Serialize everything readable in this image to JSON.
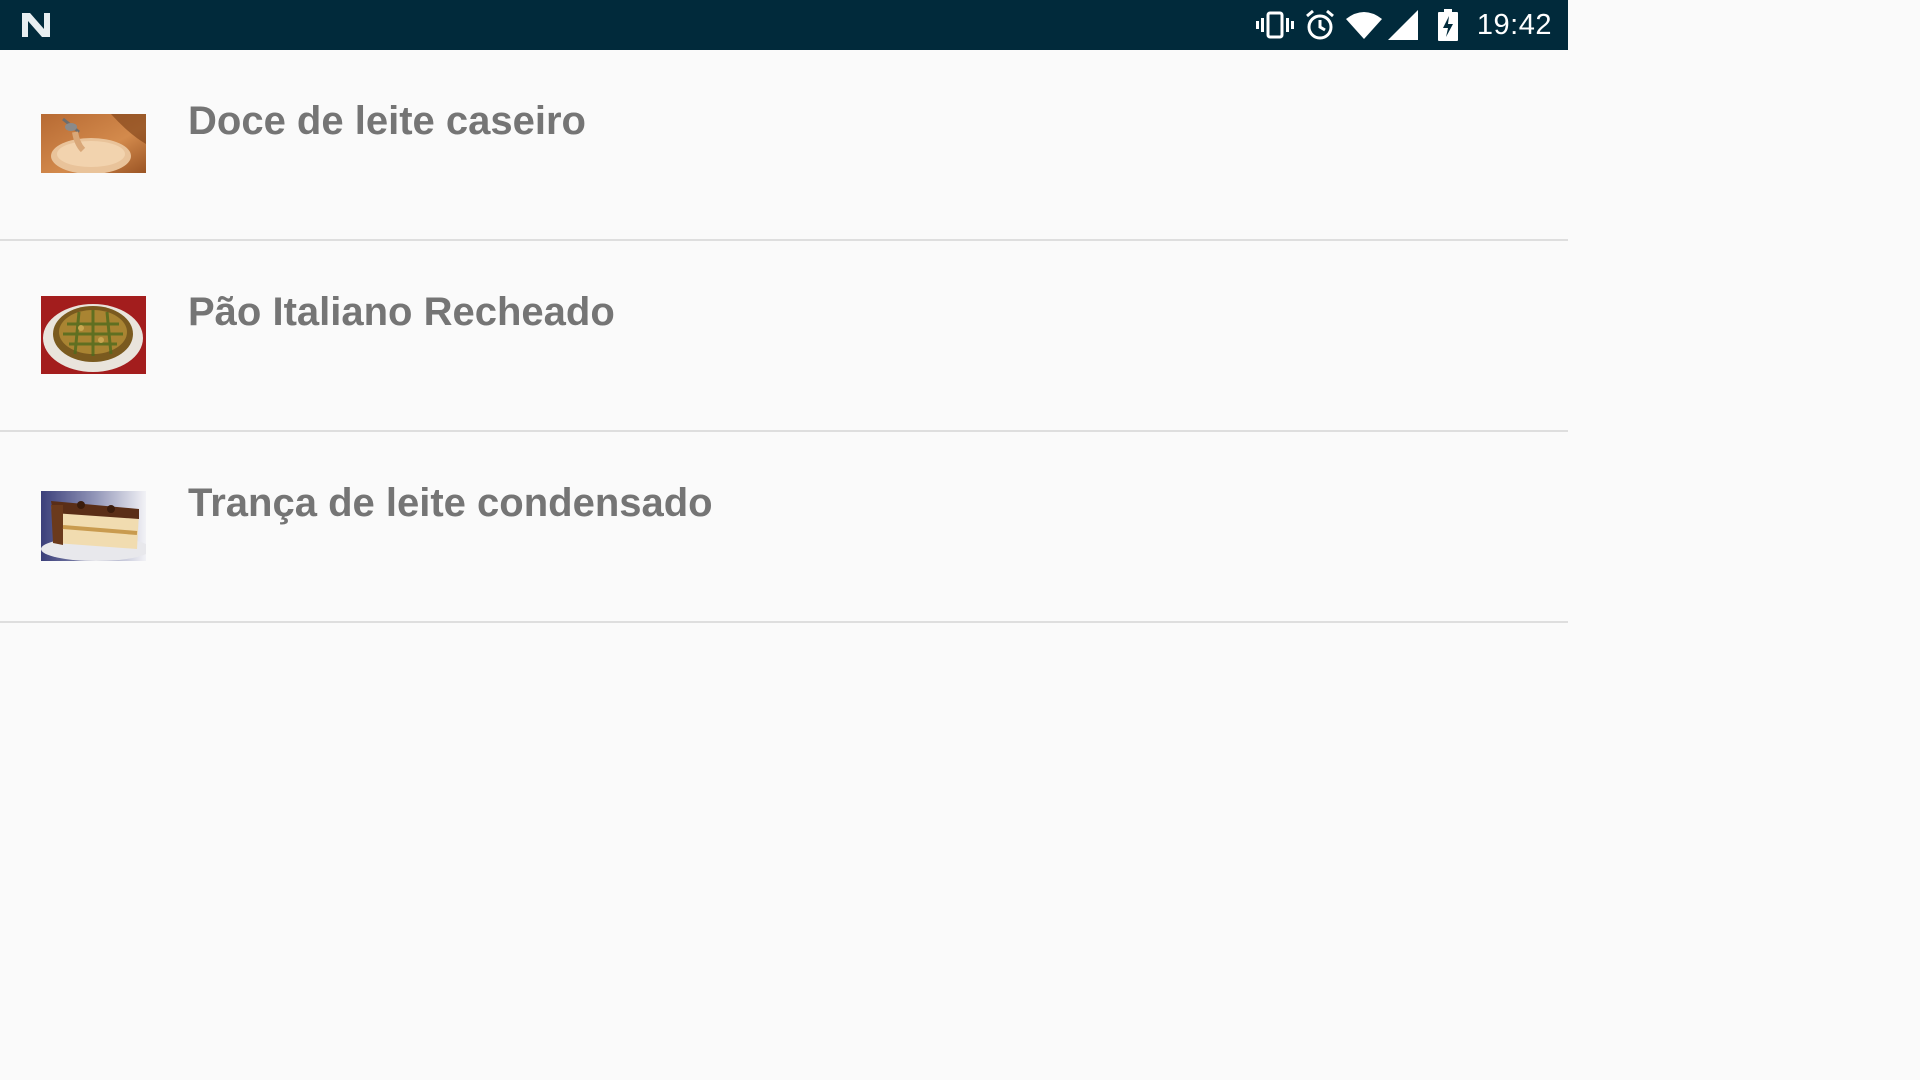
{
  "status_bar": {
    "time": "19:42",
    "icons": [
      "n-logo-icon",
      "vibrate-icon",
      "alarm-icon",
      "wifi-icon",
      "cell-signal-icon",
      "battery-charging-icon"
    ],
    "background": "#012a3b"
  },
  "recipes": [
    {
      "title": "Doce de leite caseiro",
      "thumbnail": "doce-de-leite-photo"
    },
    {
      "title": "Pão Italiano Recheado",
      "thumbnail": "pao-italiano-photo"
    },
    {
      "title": "Trança de leite condensado",
      "thumbnail": "tranca-photo"
    }
  ],
  "colors": {
    "title_text": "#757575",
    "divider": "#dedede",
    "background": "#fafafa"
  }
}
